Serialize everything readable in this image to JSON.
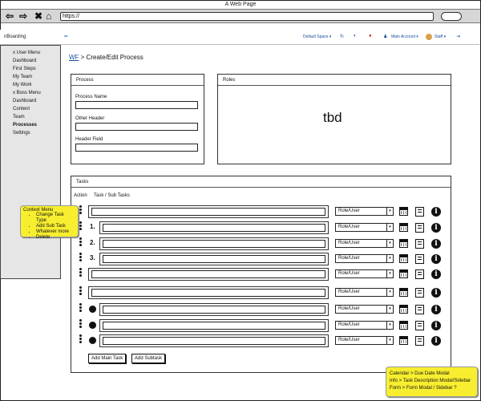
{
  "browser": {
    "title": "A Web Page",
    "url": "https://"
  },
  "app": {
    "brand": "nBoarding",
    "header": {
      "space": "Default Space ▾",
      "account": "Main Account ▾",
      "user": "Staff ▾"
    }
  },
  "sidebar": {
    "items": [
      {
        "label": "x User Menu",
        "bold": false
      },
      {
        "label": "Dashboard",
        "bold": false
      },
      {
        "label": "First Steps",
        "bold": false
      },
      {
        "label": "My Team",
        "bold": false
      },
      {
        "label": "My Work",
        "bold": false
      },
      {
        "label": "x Boss Menu",
        "bold": false
      },
      {
        "label": "Dashboard",
        "bold": false
      },
      {
        "label": "Content",
        "bold": false
      },
      {
        "label": "Team",
        "bold": false
      },
      {
        "label": "Processes",
        "bold": true
      },
      {
        "label": "Settings",
        "bold": false
      }
    ]
  },
  "page": {
    "breadcrumb_link": "WF",
    "title": " > Create/Edit Process"
  },
  "process_panel": {
    "header": "Process",
    "fields": [
      {
        "label": "Process Name",
        "value": ""
      },
      {
        "label": "Other Header",
        "value": ""
      },
      {
        "label": "Header Field",
        "value": ""
      }
    ]
  },
  "roles_panel": {
    "header": "Roles",
    "content": "tbd"
  },
  "tasks_panel": {
    "header": "Tasks",
    "col_action": "Action",
    "col_tasks": "Task / Sub Tasks",
    "rows": [
      {
        "marker": "",
        "role": "Role/User"
      },
      {
        "marker": "1.",
        "role": "Role/User"
      },
      {
        "marker": "2.",
        "role": "Role/User"
      },
      {
        "marker": "3.",
        "role": "Role/User"
      },
      {
        "marker": "",
        "role": "Role/User"
      },
      {
        "marker": "",
        "role": "Role/User"
      },
      {
        "marker": "bullet",
        "role": "Role/User"
      },
      {
        "marker": "bullet",
        "role": "Role/User"
      },
      {
        "marker": "bullet",
        "role": "Role/User"
      }
    ],
    "add_main_task": "Add Main Task",
    "add_subtask": "Add Subtask"
  },
  "context_note": {
    "title": "Context Menu",
    "items": [
      "Change Task Type",
      "Add Sub Task",
      "Whatever more",
      "Delete"
    ]
  },
  "legend_note": {
    "lines": [
      "Calendar > Due Date Modal",
      "Info > Task Description Modal/Sidebar",
      "Form > Form Modal / Sidebar ?"
    ]
  },
  "colors": {
    "note_yellow": "#f8ee30",
    "link_blue": "#1a4fa0",
    "sidebar_gray": "#e6e6e6"
  },
  "icons": [
    "back-arrow-icon",
    "forward-arrow-icon",
    "close-icon",
    "home-icon",
    "calendar-icon",
    "form-icon",
    "info-icon",
    "drag-handle-icon"
  ]
}
